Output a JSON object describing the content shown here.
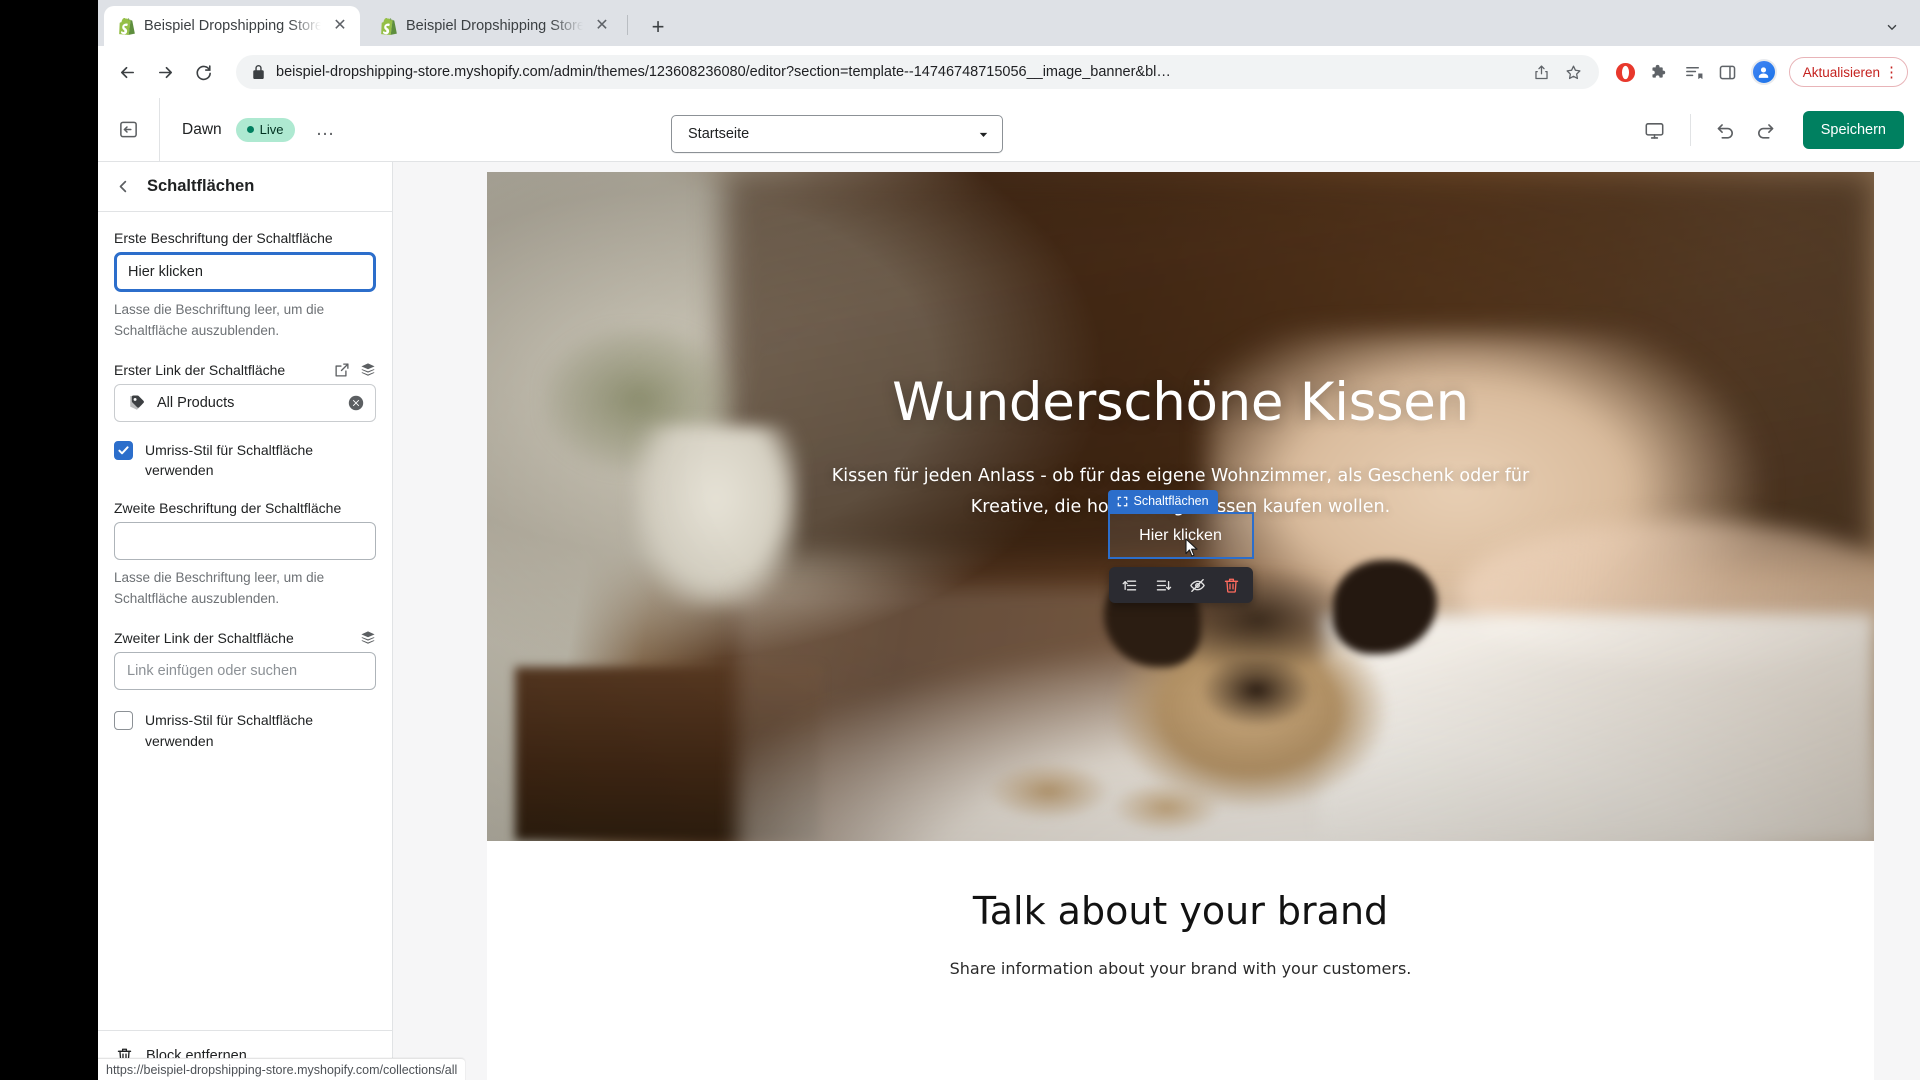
{
  "browser": {
    "tabs": [
      {
        "title": "Beispiel Dropshipping Store · D",
        "favicon": "shopify-icon",
        "active": true
      },
      {
        "title": "Beispiel Dropshipping Store · B",
        "favicon": "shopify-icon",
        "active": false
      }
    ],
    "new_tab_label": "+",
    "tabstrip_collapse_icon": "chevron-down-icon",
    "nav": {
      "back_icon": "arrow-back-icon",
      "forward_icon": "arrow-forward-icon",
      "reload_icon": "reload-icon"
    },
    "omnibox": {
      "lock_icon": "lock-icon",
      "url": "beispiel-dropshipping-store.myshopify.com/admin/themes/123608236080/editor?section=template--14746748715056__image_banner&bl…",
      "share_icon": "share-icon",
      "bookmark_icon": "star-icon"
    },
    "extensions": [
      {
        "name": "opera-extension-icon",
        "color": "#e8382c"
      },
      {
        "name": "puzzle-extension-icon"
      },
      {
        "name": "reading-list-icon"
      },
      {
        "name": "side-panel-icon"
      }
    ],
    "profile_avatar": "profile-avatar",
    "update_button": {
      "label": "Aktualisieren",
      "menu_icon": "kebab-menu-icon",
      "color": "#c5221f"
    }
  },
  "editor": {
    "exit_icon": "exit-editor-icon",
    "theme_name": "Dawn",
    "live_badge": "Live",
    "more_menu": "…",
    "page_select": {
      "value": "Startseite",
      "caret_icon": "chevron-down-icon"
    },
    "inspect_button": "inspector-icon",
    "devices": {
      "desktop_icon": "desktop-icon"
    },
    "undo_icon": "undo-icon",
    "redo_icon": "redo-icon",
    "save_label": "Speichern",
    "save_color": "#008060"
  },
  "sidebar": {
    "back_icon": "chevron-left-icon",
    "title": "Schaltflächen",
    "fields": {
      "first_label": {
        "label": "Erste Beschriftung der Schaltfläche",
        "value": "Hier klicken",
        "help": "Lasse die Beschriftung leer, um die Schaltfläche auszublenden."
      },
      "first_link": {
        "label": "Erster Link der Schaltfläche",
        "value": "All Products",
        "icons": [
          "external-link-icon",
          "collection-stack-icon"
        ],
        "prefix_icon": "tag-icon",
        "clear_icon": "clear-circle-icon"
      },
      "first_outline": {
        "label": "Umriss-Stil für Schaltfläche verwenden",
        "checked": true
      },
      "second_label": {
        "label": "Zweite Beschriftung der Schaltfläche",
        "value": "",
        "placeholder": "",
        "help": "Lasse die Beschriftung leer, um die Schaltfläche auszublenden."
      },
      "second_link": {
        "label": "Zweiter Link der Schaltfläche",
        "placeholder": "Link einfügen oder suchen",
        "icons": [
          "collection-stack-icon"
        ]
      },
      "second_outline": {
        "label": "Umriss-Stil für Schaltfläche verwenden",
        "checked": false
      }
    },
    "remove_block": {
      "label": "Block entfernen",
      "icon": "trash-icon"
    }
  },
  "preview": {
    "hero": {
      "heading": "Wunderschöne Kissen",
      "subheading_line1": "Kissen für jeden Anlass - ob für das eigene Wohnzimmer, als Geschenk oder für",
      "subheading_line2": "Kreative, die hochwertige Kissen kaufen wollen."
    },
    "block_overlay": {
      "tag_label": "Schaltflächen",
      "tag_icon": "block-select-icon",
      "button_label": "Hier klicken",
      "accent": "#2c6ecb",
      "toolbar_buttons": [
        {
          "name": "move-up-icon"
        },
        {
          "name": "move-down-icon"
        },
        {
          "name": "hide-eye-icon"
        },
        {
          "name": "delete-icon"
        }
      ]
    },
    "section2": {
      "title": "Talk about your brand",
      "subtitle": "Share information about your brand with your customers."
    }
  },
  "statusbar": {
    "url": "https://beispiel-dropshipping-store.myshopify.com/collections/all"
  }
}
